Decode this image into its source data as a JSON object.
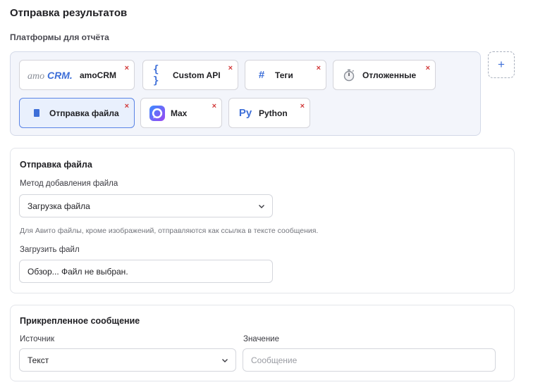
{
  "page_title": "Отправка результатов",
  "platforms": {
    "label": "Платформы для отчёта",
    "items": [
      {
        "logo": "amoCRM.",
        "label": "amoCRM",
        "icon": "amocrm-logo-icon"
      },
      {
        "logo": "{ }",
        "label": "Custom API",
        "icon": "braces-icon"
      },
      {
        "logo": "#",
        "label": "Теги",
        "icon": "hash-icon"
      },
      {
        "logo": "⏱",
        "label": "Отложенные",
        "icon": "stopwatch-icon"
      },
      {
        "logo": "",
        "label": "Отправка файла",
        "icon": "file-icon",
        "active": true
      },
      {
        "logo": "",
        "label": "Max",
        "icon": "max-logo-icon"
      },
      {
        "logo": "Py",
        "label": "Python",
        "icon": "python-icon"
      }
    ],
    "remove_glyph": "×",
    "add_glyph": "+"
  },
  "file_card": {
    "title": "Отправка файла",
    "method_label": "Метод добавления файла",
    "method_value": "Загрузка файла",
    "hint": "Для Авито файлы, кроме изображений, отправляются как ссылка в тексте сообщения.",
    "upload_label": "Загрузить файл",
    "upload_value": "Обзор... Файл не выбран."
  },
  "message_card": {
    "title": "Прикрепленное сообщение",
    "source_label": "Источник",
    "source_value": "Текст",
    "value_label": "Значение",
    "value_placeholder": "Сообщение"
  },
  "colors": {
    "accent": "#3e6fd8",
    "remove": "#d23a3a",
    "active_chip_bg": "#e9f0fd"
  }
}
